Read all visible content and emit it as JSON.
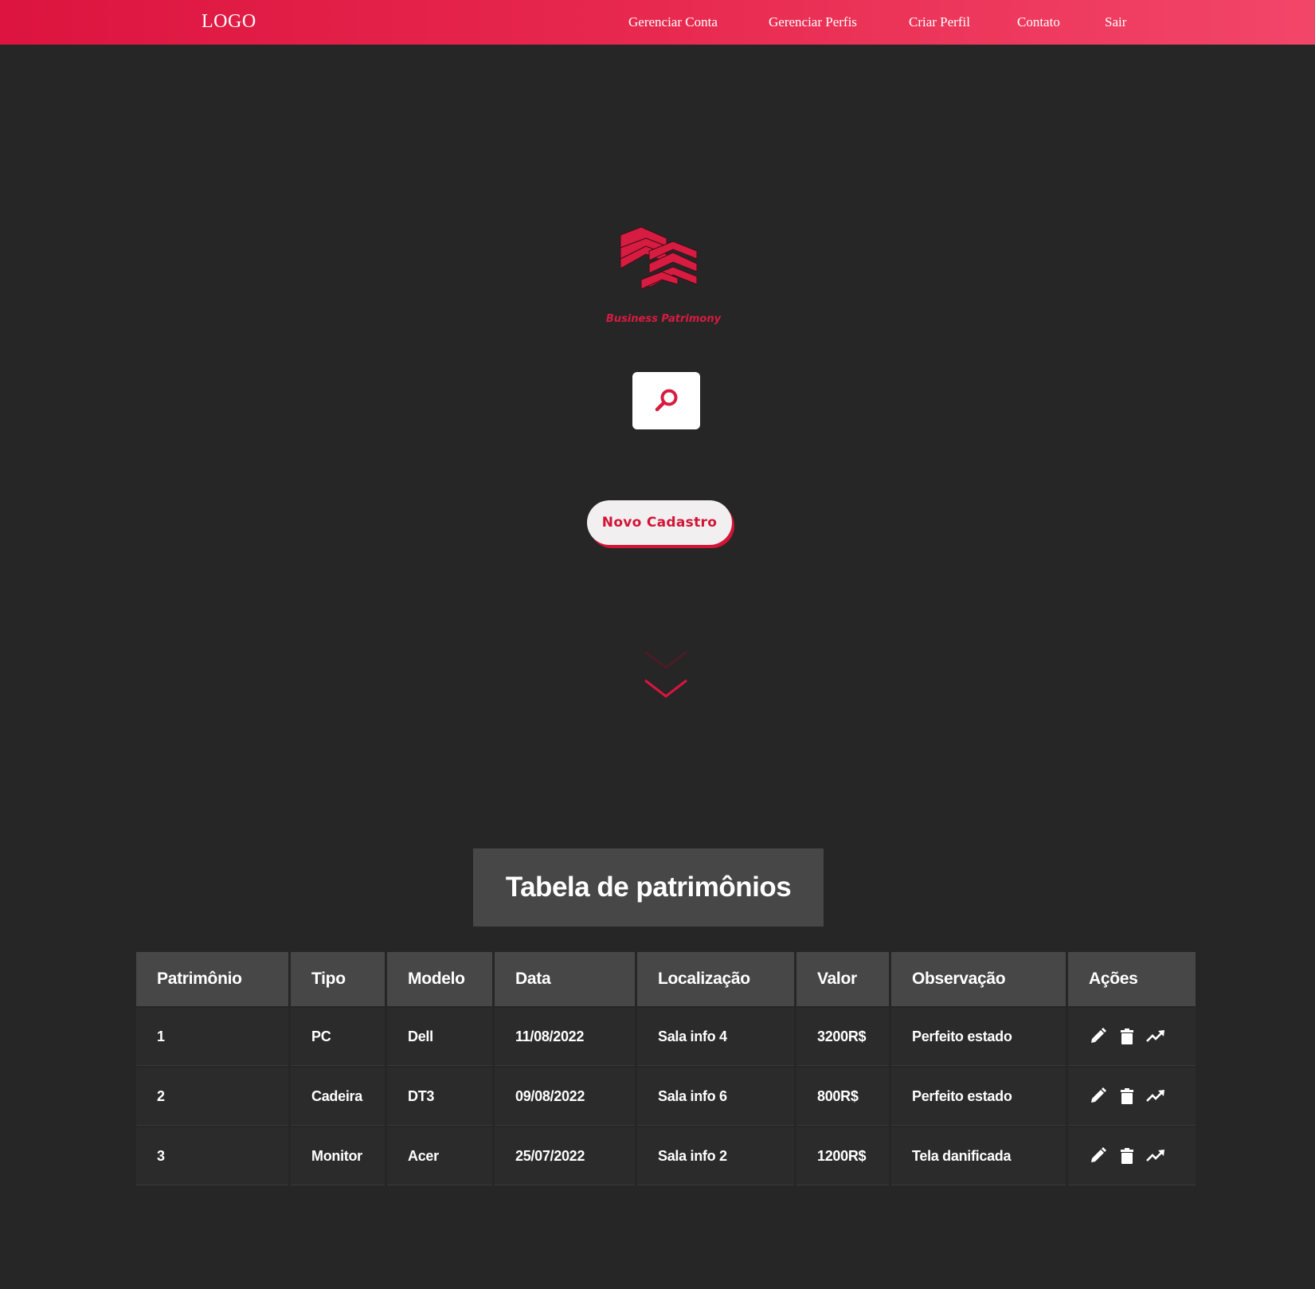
{
  "nav": {
    "logo": "LOGO",
    "links": [
      "Gerenciar Conta",
      "Gerenciar Perfis",
      "Criar Perfil",
      "Contato",
      "Sair"
    ]
  },
  "brand": {
    "name": "Business Patrimony",
    "icon": "stacked-bars-logo"
  },
  "search": {
    "icon": "search-icon"
  },
  "cta": {
    "label": "Novo Cadastro"
  },
  "scroll_hint": {
    "icon": "chevron-down-icon"
  },
  "table": {
    "title": "Tabela de patrimônios",
    "headers": [
      "Patrimônio",
      "Tipo",
      "Modelo",
      "Data",
      "Localização",
      "Valor",
      "Observação",
      "Ações"
    ],
    "rows": [
      [
        "1",
        "PC",
        "Dell",
        "11/08/2022",
        "Sala info 4",
        "3200R$",
        "Perfeito estado"
      ],
      [
        "2",
        "Cadeira",
        "DT3",
        "09/08/2022",
        "Sala info 6",
        "800R$",
        "Perfeito estado"
      ],
      [
        "3",
        "Monitor",
        "Acer",
        "25/07/2022",
        "Sala info 2",
        "1200R$",
        "Tela danificada"
      ]
    ],
    "row_actions": [
      "pencil-icon",
      "trash-icon",
      "trending-up-icon"
    ]
  },
  "colors": {
    "accent": "#dc143f",
    "background": "#262626",
    "panel": "#474747",
    "cell": "#2b2b2b"
  }
}
